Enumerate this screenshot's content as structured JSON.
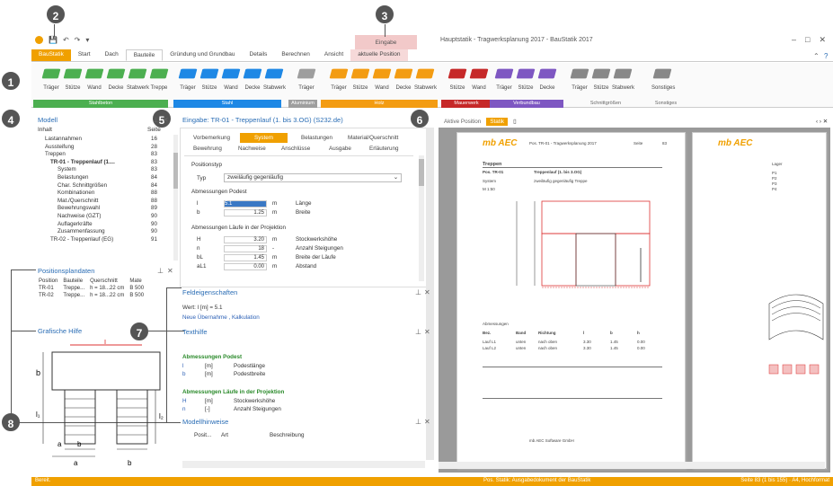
{
  "qat": {
    "save": "💾",
    "undo": "↶",
    "redo": "↷",
    "more": "▾"
  },
  "window": {
    "title": "Hauptstatik - Tragwerksplanung 2017 - BauStatik 2017",
    "min": "–",
    "max": "□",
    "close": "✕"
  },
  "tabs": [
    "BauStatik",
    "Start",
    "Dach",
    "Bauteile",
    "Gründung und Grundbau",
    "Details",
    "Berechnen",
    "Ansicht",
    "aktuelle Position"
  ],
  "context_tab_head": "Eingabe",
  "ribbon": {
    "buttons": [
      "Träger",
      "Stütze",
      "Wand",
      "Decke",
      "Stabwerk",
      "Treppe",
      "Träger",
      "Stütze",
      "Wand",
      "Decke",
      "Stabwerk",
      "Träger",
      "Träger",
      "Stütze",
      "Wand",
      "Decke",
      "Stabwerk",
      "Stütze",
      "Wand",
      "Träger",
      "Stütze",
      "Decke",
      "Träger",
      "Stütze",
      "Stabwerk",
      "Sonstiges"
    ],
    "groups": [
      "Stahlbeton",
      "Stahl",
      "Aluminium",
      "Holz",
      "Mauerwerk",
      "Verbundbau",
      "Schnittgrößen",
      "Sonstiges"
    ],
    "colors": {
      "stahlbeton": "#4caf50",
      "stahl": "#1e88e5",
      "aluminium": "#9e9e9e",
      "holz": "#f39c12",
      "mauerwerk": "#c62828",
      "verbundbau": "#7e57c2",
      "gray": "#888888"
    }
  },
  "callouts": [
    "1",
    "2",
    "3",
    "4",
    "5",
    "6",
    "7",
    "8"
  ],
  "model": {
    "title": "Modell",
    "col_inhalt": "Inhalt",
    "col_seite": "Seite",
    "rows": [
      {
        "t": "Lastannahmen",
        "n": "16"
      },
      {
        "t": "Aussteifung",
        "n": "28"
      },
      {
        "t": "Treppen",
        "n": "83"
      },
      {
        "t": "TR-01 - Treppenlauf (1....",
        "n": "83"
      },
      {
        "t": "System",
        "n": "83"
      },
      {
        "t": "Belastungen",
        "n": "84"
      },
      {
        "t": "Char. Schnittgrößen",
        "n": "84"
      },
      {
        "t": "Kombinationen",
        "n": "88"
      },
      {
        "t": "Mat./Querschnitt",
        "n": "88"
      },
      {
        "t": "Bewehrungswahl",
        "n": "89"
      },
      {
        "t": "Nachweise (GZT)",
        "n": "90"
      },
      {
        "t": "Auflagerkräfte",
        "n": "90"
      },
      {
        "t": "Zusammenfassung",
        "n": "90"
      },
      {
        "t": "TR-02 - Treppenlauf (EG)",
        "n": "91"
      }
    ]
  },
  "positionsplan": {
    "title": "Positionsplandaten",
    "headers": [
      "Position",
      "Bauteile",
      "Querschnitt",
      "Mate"
    ],
    "rows": [
      [
        "TR-01",
        "Treppe...",
        "h = 18...22 cm",
        "B 500"
      ],
      [
        "TR-02",
        "Treppe...",
        "h = 18...22 cm",
        "B 500"
      ],
      [
        "TR-03",
        "Treppe...",
        "h = 18...22 cm",
        "B 500"
      ]
    ]
  },
  "grafische_hilfe": {
    "title": "Grafische Hilfe",
    "l": "l",
    "b": "b",
    "l1": "l₁",
    "l2": "l₂",
    "al1": "a",
    "bs": "b",
    "al2": "a",
    "bs2": "b"
  },
  "editor": {
    "title": "Eingabe: TR-01 - Treppenlauf (1. bis 3.OG) (S232.de)",
    "tabs_row1": [
      "Vorbemerkung",
      "System",
      "Belastungen",
      "Material/Querschnitt"
    ],
    "tabs_row2": [
      "Bewehrung",
      "Nachweise",
      "Anschlüsse",
      "Ausgabe",
      "Erläuterung"
    ],
    "sec_typ": "Positionstyp",
    "typ_label": "Typ",
    "typ_value": "zweiläufig gegenläufig",
    "sec_podest": "Abmessungen Podest",
    "podest": [
      {
        "sym": "l",
        "val": "5.1",
        "unit": "m",
        "desc": "Länge"
      },
      {
        "sym": "b",
        "val": "1.25",
        "unit": "m",
        "desc": "Breite"
      }
    ],
    "sec_laeufe": "Abmessungen Läufe in der Projektion",
    "laeufe": [
      {
        "sym": "H",
        "val": "3.20",
        "unit": "m",
        "desc": "Stockwerkshöhe"
      },
      {
        "sym": "n",
        "val": "18",
        "unit": "-",
        "desc": "Anzahl Steigungen"
      },
      {
        "sym": "bL",
        "val": "1.45",
        "unit": "m",
        "desc": "Breite der Läufe"
      },
      {
        "sym": "aL1",
        "val": "0.00",
        "unit": "m",
        "desc": "Abstand"
      }
    ]
  },
  "feld": {
    "title": "Feldeigenschaften",
    "wert": "Wert: l [m] = 5.1",
    "links": "Neue Übernahme , Kalkulation"
  },
  "texthilfe": {
    "title": "Texthilfe",
    "h1": "Abmessungen Podest",
    "r1": [
      [
        "l",
        "[m]",
        "Podestlänge"
      ],
      [
        "b",
        "[m]",
        "Podestbreite"
      ]
    ],
    "h2": "Abmessungen Läufe in der Projektion",
    "r2": [
      [
        "H",
        "[m]",
        "Stockwerkshöhe"
      ],
      [
        "n",
        "[-]",
        "Anzahl Steigungen"
      ]
    ]
  },
  "modellhinweise": {
    "title": "Modellhinweise",
    "headers": [
      "Posit...",
      "Art",
      "Beschreibung"
    ]
  },
  "preview": {
    "tabs": [
      "Aktive Position",
      "Statik"
    ],
    "page1": {
      "logo": "mb AEC",
      "hdr": [
        "Pos. TR-01 - Tragwerksplanung 2017",
        "Seite",
        "83"
      ],
      "title": "Treppen",
      "pos": "Pos. TR-01",
      "pos_title": "Treppenlauf (1. bis 3.OG)",
      "system": "System",
      "system_desc": "zweiläufig gegenläufig Treppe",
      "scale": "M 1:50",
      "table_head": [
        "Bez.",
        "Band",
        "Richtung",
        "l",
        "b",
        "h"
      ],
      "t_rows": [
        [
          "Lauf L1",
          "unten",
          "nach oben",
          "3.30",
          "1.45",
          "0.00"
        ],
        [
          "Lauf L2",
          "unten",
          "nach oben",
          "3.30",
          "1.45",
          "0.00"
        ]
      ],
      "label_hoehe": "Abmessungen",
      "footer": "mb AEC Software GmbH"
    },
    "page2": {
      "logo": "mb AEC",
      "label_laeufe": "Lager",
      "items": [
        "P1",
        "P2",
        "P3",
        "P4"
      ]
    }
  },
  "status": {
    "left": "Bereit.",
    "mid": "Pos. Statik: Ausgabedokument der BauStatik",
    "right": "Seite 83 (1 bis 155) · A4, Hochformat"
  }
}
